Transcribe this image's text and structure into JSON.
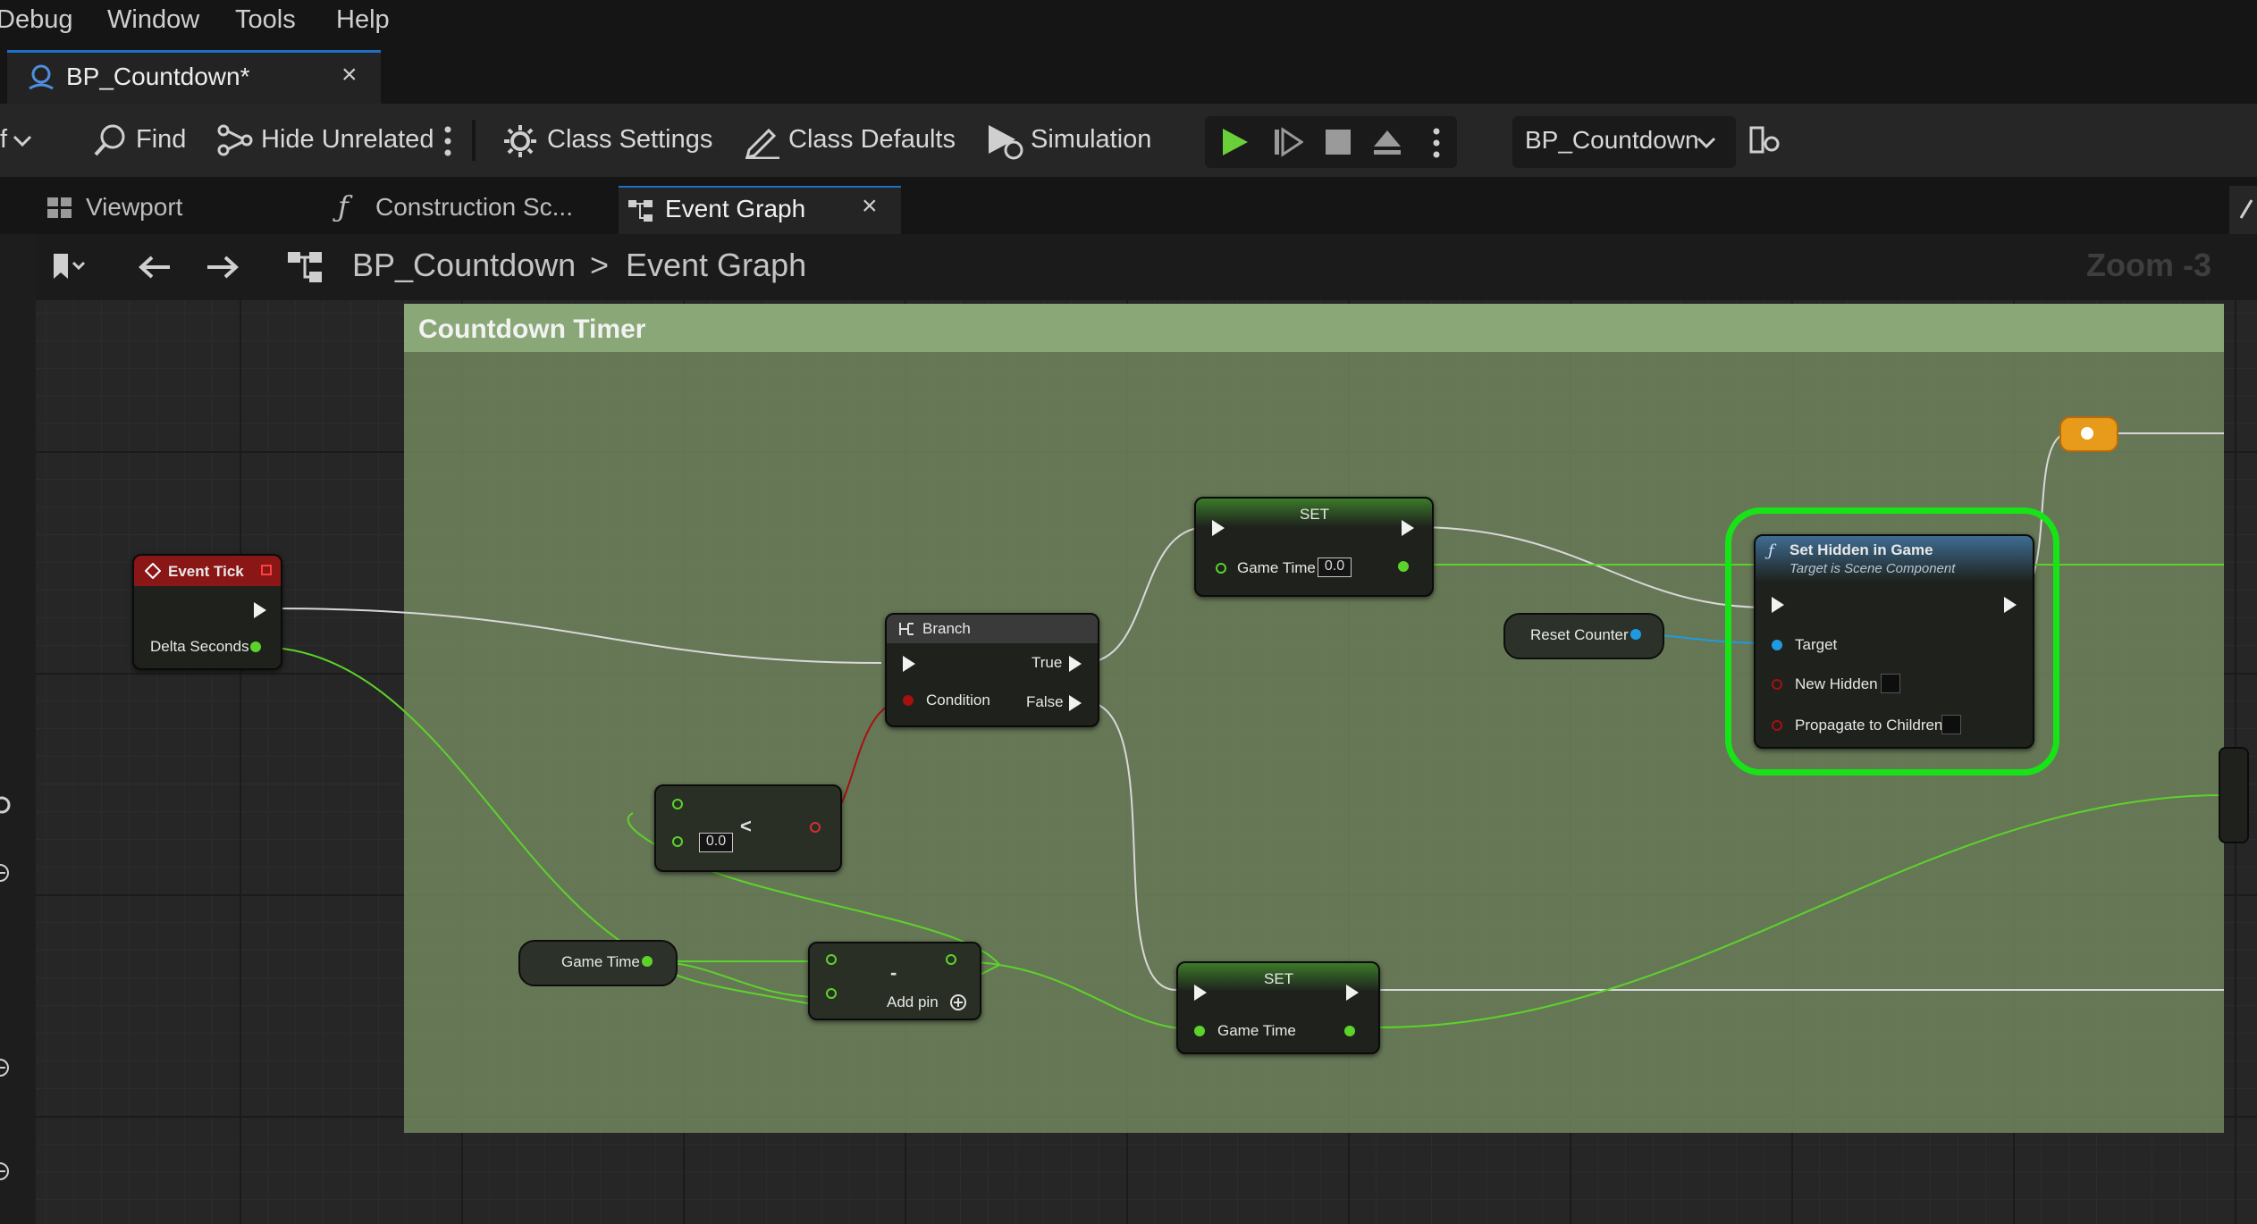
{
  "menu": [
    "Debug",
    "Window",
    "Tools",
    "Help"
  ],
  "doc_tab": {
    "title": "BP_Countdown*",
    "close": "×"
  },
  "toolbar": {
    "truncated": "f",
    "find": "Find",
    "hide_unrelated": "Hide Unrelated",
    "class_settings": "Class Settings",
    "class_defaults": "Class Defaults",
    "simulation": "Simulation",
    "debug_object": "BP_Countdown"
  },
  "subtabs": {
    "viewport": "Viewport",
    "construction": "Construction Sc...",
    "event_graph": "Event Graph",
    "close": "×"
  },
  "breadcrumb": {
    "blueprint": "BP_Countdown",
    "separator": ">",
    "graph": "Event Graph",
    "zoom": "Zoom -3"
  },
  "comment": {
    "title": "Countdown Timer"
  },
  "nodes": {
    "event_tick": {
      "title": "Event Tick",
      "pin": "Delta Seconds"
    },
    "branch": {
      "title": "Branch",
      "condition": "Condition",
      "true": "True",
      "false": "False"
    },
    "less": {
      "op": "<",
      "value": "0.0"
    },
    "set_top": {
      "title": "SET",
      "var": "Game Time",
      "value": "0.0"
    },
    "set_bottom": {
      "title": "SET",
      "var": "Game Time"
    },
    "reset_counter": {
      "label": "Reset Counter"
    },
    "game_time_get": {
      "label": "Game Time"
    },
    "subtract": {
      "op": "-",
      "add_pin": "Add pin"
    },
    "set_hidden": {
      "title": "Set Hidden in Game",
      "subtitle": "Target is Scene Component",
      "target": "Target",
      "new_hidden": "New Hidden",
      "propagate": "Propagate to Children"
    }
  },
  "colors": {
    "exec": "#f2f2f2",
    "float": "#5cd32a",
    "bool": "#a61010",
    "object": "#1e9be0",
    "highlight": "#17e417"
  }
}
